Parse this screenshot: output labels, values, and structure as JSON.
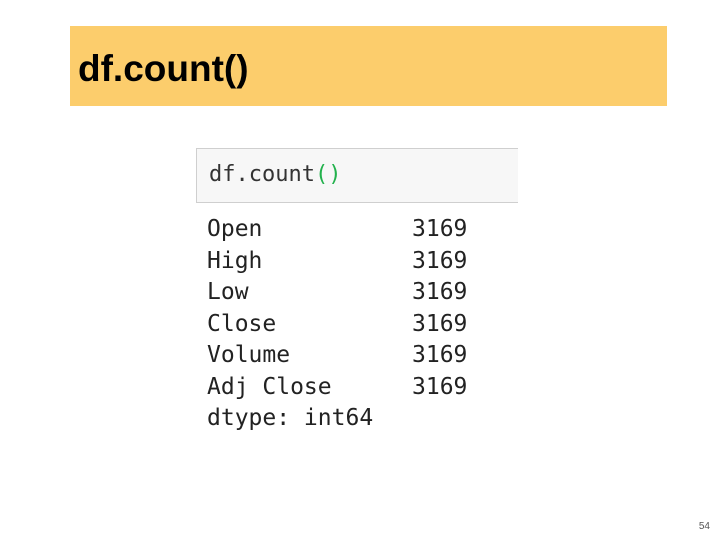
{
  "slide": {
    "title": "df.count()",
    "page_number": "54"
  },
  "code_cell": {
    "prefix": "df.count",
    "parens": "()"
  },
  "output": {
    "rows": [
      {
        "key": "Open",
        "value": "3169"
      },
      {
        "key": "High",
        "value": "3169"
      },
      {
        "key": "Low",
        "value": "3169"
      },
      {
        "key": "Close",
        "value": "3169"
      },
      {
        "key": "Volume",
        "value": "3169"
      },
      {
        "key": "Adj Close",
        "value": "3169"
      }
    ],
    "dtype": "dtype: int64"
  },
  "colors": {
    "title_band": "#fccd6c",
    "paren_green": "#22b14c"
  }
}
